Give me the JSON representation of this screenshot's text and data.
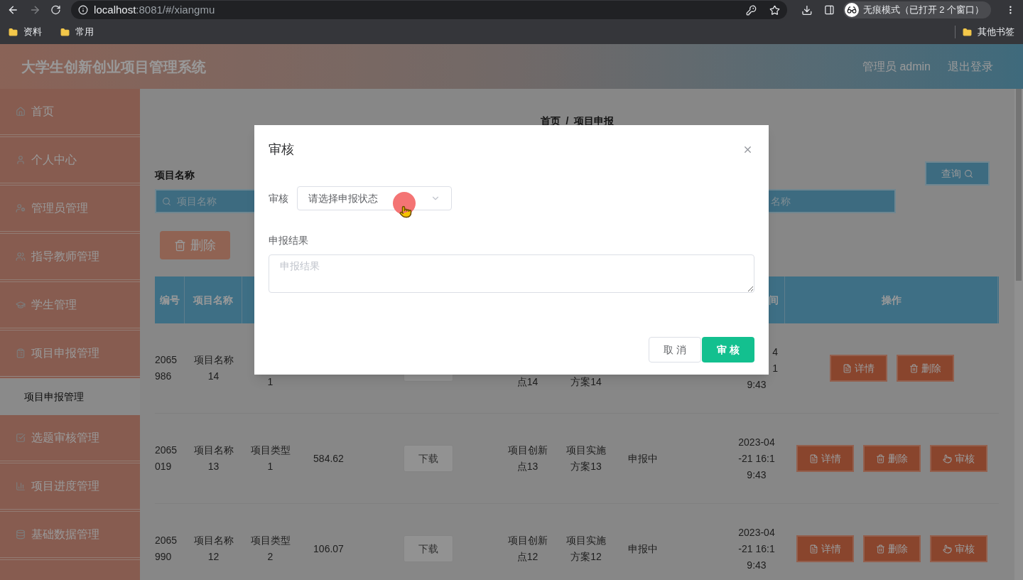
{
  "browser": {
    "url_host": "localhost",
    "url_path": ":8081/#/xiangmu",
    "profile_label": "无痕模式（已打开 2 个窗口）",
    "bookmarks": [
      "资料",
      "常用"
    ],
    "other_bookmarks": "其他书签"
  },
  "header": {
    "title": "大学生创新创业项目管理系统",
    "user": "管理员 admin",
    "logout": "退出登录"
  },
  "sidebar": {
    "items": [
      {
        "label": "首页",
        "expanded": false
      },
      {
        "label": "个人中心",
        "expanded": false
      },
      {
        "label": "管理员管理",
        "expanded": false
      },
      {
        "label": "指导教师管理",
        "expanded": false
      },
      {
        "label": "学生管理",
        "expanded": false
      },
      {
        "label": "项目申报管理",
        "expanded": true,
        "children": [
          {
            "label": "项目申报管理",
            "selected": true
          }
        ]
      },
      {
        "label": "选题审核管理",
        "expanded": false
      },
      {
        "label": "项目进度管理",
        "expanded": false
      },
      {
        "label": "基础数据管理",
        "expanded": false
      }
    ]
  },
  "breadcrumb": {
    "items": [
      "首页",
      "项目申报"
    ],
    "separator": "/"
  },
  "search": {
    "label": "项目名称",
    "placeholder": "项目名称",
    "second_placeholder": "名称",
    "query_button": "查询"
  },
  "delete_button": "删除",
  "table": {
    "columns": [
      "编号",
      "项目名称",
      "间",
      "操作"
    ],
    "rows": [
      {
        "covered_top": true,
        "id": [
          "2065",
          "986"
        ],
        "name": [
          "项目名称",
          "14"
        ],
        "type": [
          "1"
        ],
        "innovation": [
          "点14"
        ],
        "plan": [
          "方案14"
        ],
        "time": [
          "4",
          "1",
          "9:43"
        ],
        "actions": [
          {
            "label": "详情",
            "kind": "detail"
          },
          {
            "label": "删除",
            "kind": "delete"
          }
        ]
      },
      {
        "id": [
          "2065",
          "019"
        ],
        "name": [
          "项目名称",
          "13"
        ],
        "type": [
          "项目类型",
          "1"
        ],
        "fee": "584.62",
        "file": "下载",
        "innovation": [
          "项目创新",
          "点13"
        ],
        "plan": [
          "项目实施",
          "方案13"
        ],
        "status": "申报中",
        "time": [
          "2023-04",
          "-21 16:1",
          "9:43"
        ],
        "actions": [
          {
            "label": "详情",
            "kind": "detail"
          },
          {
            "label": "删除",
            "kind": "delete"
          },
          {
            "label": "审核",
            "kind": "review"
          }
        ]
      },
      {
        "id": [
          "2065",
          "990"
        ],
        "name": [
          "项目名称",
          "12"
        ],
        "type": [
          "项目类型",
          "2"
        ],
        "fee": "106.07",
        "file": "下载",
        "innovation": [
          "项目创新",
          "点12"
        ],
        "plan": [
          "项目实施",
          "方案12"
        ],
        "status": "申报中",
        "time": [
          "2023-04",
          "-21 16:1",
          "9:43"
        ],
        "actions": [
          {
            "label": "详情",
            "kind": "detail"
          },
          {
            "label": "删除",
            "kind": "delete"
          },
          {
            "label": "审核",
            "kind": "review"
          }
        ]
      }
    ]
  },
  "dialog": {
    "title": "审核",
    "status_label": "审核",
    "status_placeholder": "请选择申报状态",
    "result_label": "申报结果",
    "result_placeholder": "申报结果",
    "buttons": [
      {
        "label": "取 消",
        "kind": "default"
      },
      {
        "label": "审 核",
        "kind": "primary"
      }
    ]
  }
}
